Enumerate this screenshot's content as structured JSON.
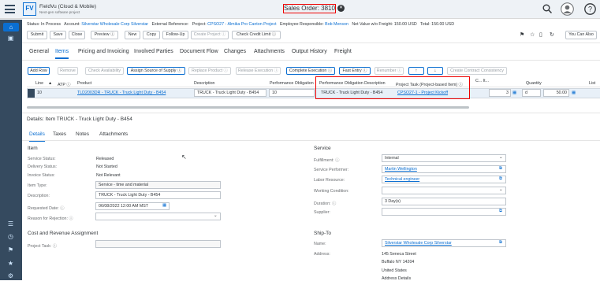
{
  "shell": {
    "app_name": "FieldVu (Cloud & Mobile)",
    "app_sub": "Next-gen software project",
    "logo": "FV",
    "title": "Sales Order: 3810",
    "close_label": "✕"
  },
  "header": {
    "status_label": "Status:",
    "status": "In Process",
    "account_label": "Account:",
    "account": "Silverstar Wholesale Corp Silverstar",
    "extref_label": "External Reference:",
    "project_label": "Project:",
    "project": "CPSO27 - Almika Pro Canton Project",
    "emp_label": "Employee Responsible:",
    "employee": "Bob Menson",
    "net_label": "Net Value w/o Freight:",
    "net": "150.00 USD",
    "total_label": "Total:",
    "total": "150.00 USD"
  },
  "toolbar": [
    "Submit",
    "Save",
    "Close",
    "Preview ⓘ",
    "New",
    "Copy",
    "Follow-Up",
    "Create Project ⓘ",
    "Check Credit Limit ⓘ"
  ],
  "you_can_also": "You Can Also",
  "tabs": [
    "General",
    "Items",
    "Pricing and Invoicing",
    "Involved Parties",
    "Document Flow",
    "Changes",
    "Attachments",
    "Output History",
    "Freight"
  ],
  "item_actions": [
    "Add Row",
    "Remove",
    "Check Availability",
    "Assign Source of Supply ⓘ",
    "Replace Product ⓘ",
    "Release Execution ⓘ",
    "Complete Execution ⓘ",
    "Fast Entry ⓘ",
    "Renumber ⓘ",
    "↑",
    "↓",
    "Create Contract Consistency"
  ],
  "columns": {
    "line": "Line",
    "atp": "ATP ⓘ",
    "product": "Product",
    "description": "Description",
    "perf": "Performance Obligation",
    "perf_desc": "Performance Obligation Description",
    "task": "Project Task (Project-based Item) ⓘ",
    "c_it": "C... It...",
    "qty": "Quantity",
    "list": "List"
  },
  "row": {
    "line": "10",
    "product": "TLD2003DR - TRUCK - Truck Light Duty - B454",
    "description": "TRUCK - Truck Light Duty - B454",
    "perf": "10",
    "perf_desc": "TRUCK - Truck Light Duty - B454",
    "task": "CPSO27-1 - Project Kickoff",
    "qty": "3",
    "unit": "d",
    "list": "50.00"
  },
  "details": {
    "title": "Details: Item TRUCK - Truck Light Duty - B454",
    "tabs": [
      "Details",
      "Taxes",
      "Notes",
      "Attachments"
    ]
  },
  "item": {
    "section": "Item",
    "service_status_label": "Service Status:",
    "service_status": "Released",
    "delivery_status_label": "Delivery Status:",
    "delivery_status": "Not Started",
    "invoice_status_label": "Invoice Status:",
    "invoice_status": "Not Relevant",
    "item_type_label": "Item Type:",
    "item_type": "Service - time and material",
    "desc_label": "Description:",
    "desc": "TRUCK - Truck Light Duty - B454",
    "req_date_label": "Requested Date: ⓘ",
    "req_date": "06/08/2022 12:00 AM MST",
    "rejection_label": "Reason for Rejection: ⓘ"
  },
  "cost": {
    "section": "Cost and Revenue Assignment",
    "task_label": "Project Task: ⓘ"
  },
  "service": {
    "section": "Service",
    "fulfillment_label": "Fulfillment: ⓘ",
    "fulfillment": "Internal",
    "performer_label": "Service Performer:",
    "performer": "Martin Wellington",
    "labor_label": "Labor Resource:",
    "labor": "Technical engineer",
    "working_label": "Working Condition:",
    "duration_label": "Duration: ⓘ",
    "duration": "3 Day(s)",
    "supplier_label": "Supplier:"
  },
  "shipto": {
    "section": "Ship-To",
    "name_label": "Name:",
    "name": "Silverstar Wholesale Corp Silverstar",
    "address_label": "Address:",
    "addr1": "145 Seneca Street",
    "addr2": "Buffalo NY 14204",
    "addr3": "United States",
    "addr_link": "Address Details"
  }
}
